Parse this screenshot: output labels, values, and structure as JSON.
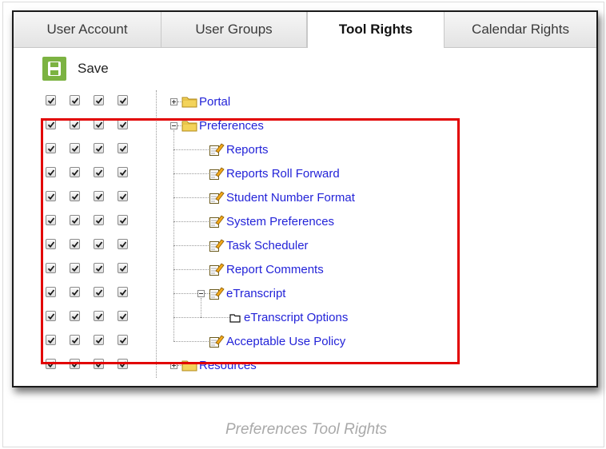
{
  "tabs": [
    {
      "label": "User Account",
      "active": false
    },
    {
      "label": "User Groups",
      "active": false
    },
    {
      "label": "Tool Rights",
      "active": true
    },
    {
      "label": "Calendar Rights",
      "active": false
    }
  ],
  "toolbar": {
    "save_label": "Save",
    "save_icon": "floppy-disk-icon",
    "save_color": "#7cb342"
  },
  "tree": [
    {
      "label": "Portal",
      "depth": 0,
      "icon": "folder-icon",
      "expander": "plus",
      "checked": [
        true,
        true,
        true,
        true
      ]
    },
    {
      "label": "Preferences",
      "depth": 0,
      "icon": "folder-icon",
      "expander": "minus",
      "checked": [
        true,
        true,
        true,
        true
      ]
    },
    {
      "label": "Reports",
      "depth": 1,
      "icon": "tool-icon",
      "expander": null,
      "checked": [
        true,
        true,
        true,
        true
      ]
    },
    {
      "label": "Reports Roll Forward",
      "depth": 1,
      "icon": "tool-icon",
      "expander": null,
      "checked": [
        true,
        true,
        true,
        true
      ]
    },
    {
      "label": "Student Number Format",
      "depth": 1,
      "icon": "tool-icon",
      "expander": null,
      "checked": [
        true,
        true,
        true,
        true
      ]
    },
    {
      "label": "System Preferences",
      "depth": 1,
      "icon": "tool-icon",
      "expander": null,
      "checked": [
        true,
        true,
        true,
        true
      ]
    },
    {
      "label": "Task Scheduler",
      "depth": 1,
      "icon": "tool-icon",
      "expander": null,
      "checked": [
        true,
        true,
        true,
        true
      ]
    },
    {
      "label": "Report Comments",
      "depth": 1,
      "icon": "tool-icon",
      "expander": null,
      "checked": [
        true,
        true,
        true,
        true
      ]
    },
    {
      "label": "eTranscript",
      "depth": 1,
      "icon": "tool-icon",
      "expander": "minus",
      "checked": [
        true,
        true,
        true,
        true
      ]
    },
    {
      "label": "eTranscript Options",
      "depth": 2,
      "icon": "subtab-icon",
      "expander": null,
      "checked": [
        true,
        true,
        true,
        true
      ]
    },
    {
      "label": "Acceptable Use Policy",
      "depth": 1,
      "icon": "tool-icon",
      "expander": null,
      "checked": [
        true,
        true,
        true,
        true
      ]
    },
    {
      "label": "Resources",
      "depth": 0,
      "icon": "folder-icon",
      "expander": "plus",
      "checked": [
        true,
        true,
        true,
        true
      ]
    }
  ],
  "colors": {
    "highlight": "#e20000",
    "link": "#2323d8",
    "folder": "#f3d35a"
  },
  "caption": "Preferences Tool Rights"
}
